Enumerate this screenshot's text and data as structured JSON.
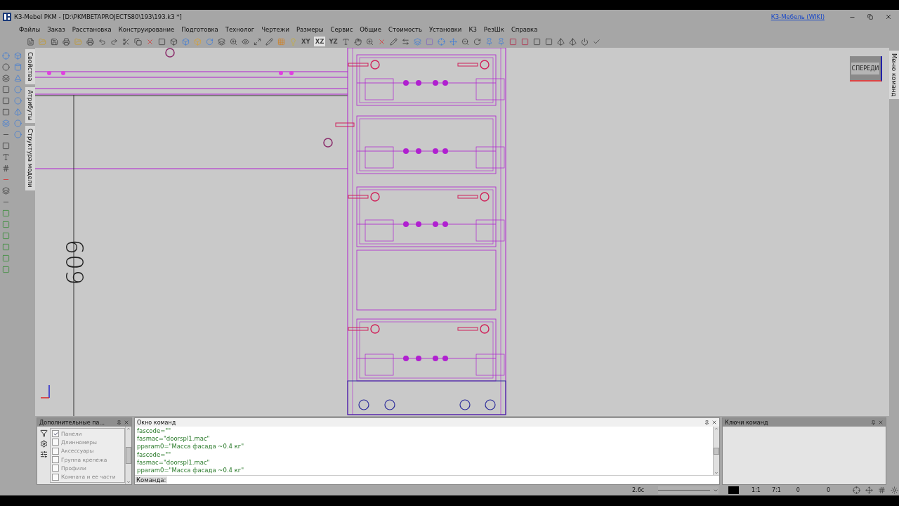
{
  "window": {
    "title": "К3-Mebel PKM - [D:\\PKMBETAPROJECTS80\\193\\193.k3 *]",
    "link": "К3-Мебель (WIKI)"
  },
  "menu": [
    "Файлы",
    "Заказ",
    "Расстановка",
    "Конструирование",
    "Подготовка",
    "Технолог",
    "Чертежи",
    "Размеры",
    "Сервис",
    "Общие",
    "Стоимость",
    "Установки",
    "К3",
    "РезШк",
    "Справка"
  ],
  "view_planes": [
    {
      "label": "XY",
      "selected": false
    },
    {
      "label": "XZ",
      "selected": true
    },
    {
      "label": "YZ",
      "selected": false
    }
  ],
  "side_tabs": [
    "Свойства",
    "Атрибуты",
    "Структура модели"
  ],
  "right_tab": "Меню команд",
  "view_cube": "СПЕРЕДИ",
  "drawing": {
    "dimension": "609"
  },
  "extra_panel": {
    "title": "Дополнительные па...",
    "items": [
      {
        "label": "Панели",
        "checked": true
      },
      {
        "label": "Длинномеры",
        "checked": false
      },
      {
        "label": "Аксессуары",
        "checked": false
      },
      {
        "label": "Группа крепежа",
        "checked": false
      },
      {
        "label": "Профили",
        "checked": false
      },
      {
        "label": "Комната и ее части",
        "checked": false
      }
    ]
  },
  "command_window": {
    "title": "Окно команд",
    "lines": [
      "fascode=\"\"",
      "fasmac=\"doorspl1.mac\"",
      "pparam0=\"Масса фасада ~0.4 кг\"",
      "fascode=\"\"",
      "fasmac=\"doorspl1.mac\"",
      "pparam0=\"Масса фасада ~0.4 кг\""
    ],
    "prompt": "Команда:"
  },
  "keys_panel": {
    "title": "Ключи команд"
  },
  "status_bar": {
    "scale": "2.6c",
    "ratio_1": "1:1",
    "ratio_2": "7:1",
    "coord_1": "0",
    "coord_2": "0"
  }
}
